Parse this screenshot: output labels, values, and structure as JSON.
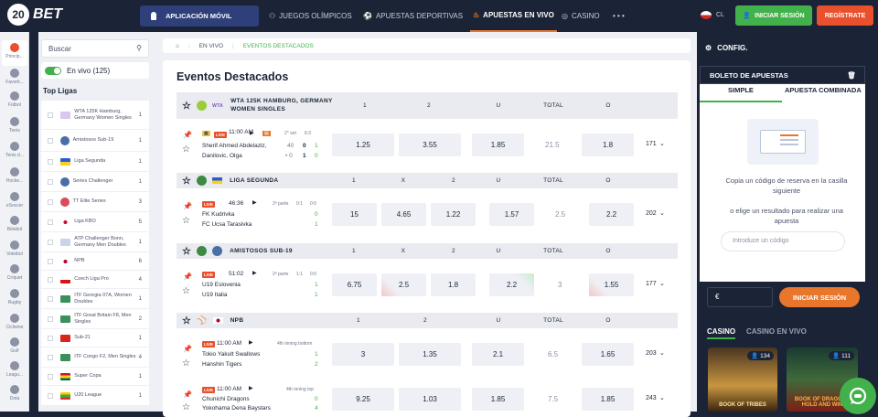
{
  "header": {
    "logo_text": "BET",
    "logo_num": "20",
    "app_button": "APLICACIÓN MÓVIL",
    "nav": [
      {
        "label": "JUEGOS OLÍMPICOS"
      },
      {
        "label": "APUESTAS DEPORTIVAS"
      },
      {
        "label": "APUESTAS EN VIVO"
      },
      {
        "label": "CASINO"
      },
      {
        "label": "• • •"
      }
    ],
    "country": "CL",
    "login": "INICIAR SESIÓN",
    "register": "REGÍSTRATE"
  },
  "sports": [
    {
      "label": "Princip..."
    },
    {
      "label": "Favorit..."
    },
    {
      "label": "Fútbol"
    },
    {
      "label": "Tenis"
    },
    {
      "label": "Tenis d..."
    },
    {
      "label": "Hocke..."
    },
    {
      "label": "eSoccer"
    },
    {
      "label": "Béisbol"
    },
    {
      "label": "Voleibol"
    },
    {
      "label": "Críquet"
    },
    {
      "label": "Rugby"
    },
    {
      "label": "Ciclismo"
    },
    {
      "label": "Golf"
    },
    {
      "label": "Leagu..."
    },
    {
      "label": "Dota"
    }
  ],
  "sidebar": {
    "search_placeholder": "Buscar",
    "live_label": "En vivo (125)",
    "top_leagues": "Top Ligas",
    "leagues": [
      {
        "name": "WTA 125K Hamburg, Germany Women Singles",
        "count": "1"
      },
      {
        "name": "Amistosos Sub-19",
        "count": "1"
      },
      {
        "name": "Liga Segunda",
        "count": "1"
      },
      {
        "name": "Series Challenger",
        "count": "1"
      },
      {
        "name": "TT Elite Series",
        "count": "3"
      },
      {
        "name": "Liga KBO",
        "count": "5"
      },
      {
        "name": "ATP Challenger Bonn, Germany Men Doubles",
        "count": "1"
      },
      {
        "name": "NPB",
        "count": "6"
      },
      {
        "name": "Czech Liga Pro",
        "count": "4"
      },
      {
        "name": "ITF Georgia 07A, Women Doubles",
        "count": "1"
      },
      {
        "name": "ITF Great Britain F8, Men Singles",
        "count": "2"
      },
      {
        "name": "Sub-21",
        "count": "1"
      },
      {
        "name": "ITF Congo F2, Men Singles",
        "count": "4"
      },
      {
        "name": "Super Copa",
        "count": "1"
      },
      {
        "name": "U20 League",
        "count": "1"
      }
    ]
  },
  "breadcrumb": {
    "live": "EN VIVO",
    "current": "EVENTOS DESTACADOS"
  },
  "main": {
    "title": "Eventos Destacados",
    "groups": [
      {
        "name": "WTA 125K HAMBURG, GERMANY WOMEN SINGLES",
        "cols": [
          "1",
          "2",
          "U",
          "TOTAL",
          "O"
        ],
        "events": [
          {
            "period": "2° set",
            "setinfo": "6:3",
            "time": "11:00 AM",
            "team1": "Sherif Ahmed Abdelaziz,",
            "team2": "Danilovic, Olga",
            "s1a": "40",
            "s1b": "0",
            "s1c": "1",
            "s2a": "• 0",
            "s2b": "1",
            "s2c": "0",
            "odds": [
              "1.25",
              "3.55",
              "1.85",
              "21.5",
              "1.8"
            ],
            "more": "171"
          }
        ]
      },
      {
        "name": "LIGA SEGUNDA",
        "cols": [
          "1",
          "X",
          "2",
          "U",
          "TOTAL",
          "O"
        ],
        "events": [
          {
            "time": "46:36",
            "period": "2ª parte",
            "halfinfo": "0:1",
            "ht": "0:0",
            "team1": "FK Kudrivka",
            "team2": "FC Ucsa Tarasivka",
            "sc1": "0",
            "sc2": "1",
            "odds": [
              "15",
              "4.65",
              "1.22",
              "1.57",
              "2.5",
              "2.2"
            ],
            "more": "202"
          }
        ]
      },
      {
        "name": "AMISTOSOS SUB-19",
        "cols": [
          "1",
          "X",
          "2",
          "U",
          "TOTAL",
          "O"
        ],
        "events": [
          {
            "time": "51:02",
            "period": "2ª parte",
            "halfinfo": "1:1",
            "ht": "0:0",
            "team1": "U19 Eslovenia",
            "team2": "U19 Italia",
            "sc1": "1",
            "sc2": "1",
            "odds": [
              "6.75",
              "2.5",
              "1.8",
              "2.2",
              "3",
              "1.55"
            ],
            "more": "177"
          }
        ]
      },
      {
        "name": "NPB",
        "cols": [
          "1",
          "2",
          "U",
          "TOTAL",
          "O"
        ],
        "events": [
          {
            "time": "11:00 AM",
            "period": "4th inning bottom",
            "team1": "Tokio Yakult Swallows",
            "team2": "Hanshin Tigers",
            "sc1": "1",
            "sc2": "2",
            "odds": [
              "3",
              "1.35",
              "2.1",
              "6.5",
              "1.65"
            ],
            "more": "203"
          },
          {
            "time": "11:00 AM",
            "period": "4th inning top",
            "team1": "Chunichi Dragons",
            "team2": "Yokohama Dena Baystars",
            "sc1": "0",
            "sc2": "4",
            "odds": [
              "9.25",
              "1.03",
              "1.85",
              "7.5",
              "1.85"
            ],
            "more": "243"
          }
        ]
      }
    ]
  },
  "betslip": {
    "config": "CONFIG.",
    "title": "BOLETO DE APUESTAS",
    "tab_simple": "SIMPLE",
    "tab_combined": "APUESTA COMBINADA",
    "hint1": "Copia un código de reserva en la casilla siguiente",
    "hint2": "o elige un resultado para realizar una apuesta",
    "code_placeholder": "Introduce un código",
    "currency": "€",
    "login": "INICIAR SESIÓN"
  },
  "casino": {
    "tab1": "CASINO",
    "tab2": "CASINO EN VIVO",
    "game1_badge": "134",
    "game2_badge": "111",
    "game1_name": "BOOK OF TRIBES",
    "game2_name": "BOOK OF DRAGONS HOLD AND WIN"
  },
  "colors": {
    "dark": "#1b2436",
    "green": "#43b14b",
    "orange": "#e8762b",
    "red": "#e8502e",
    "light": "#eef0f5"
  }
}
